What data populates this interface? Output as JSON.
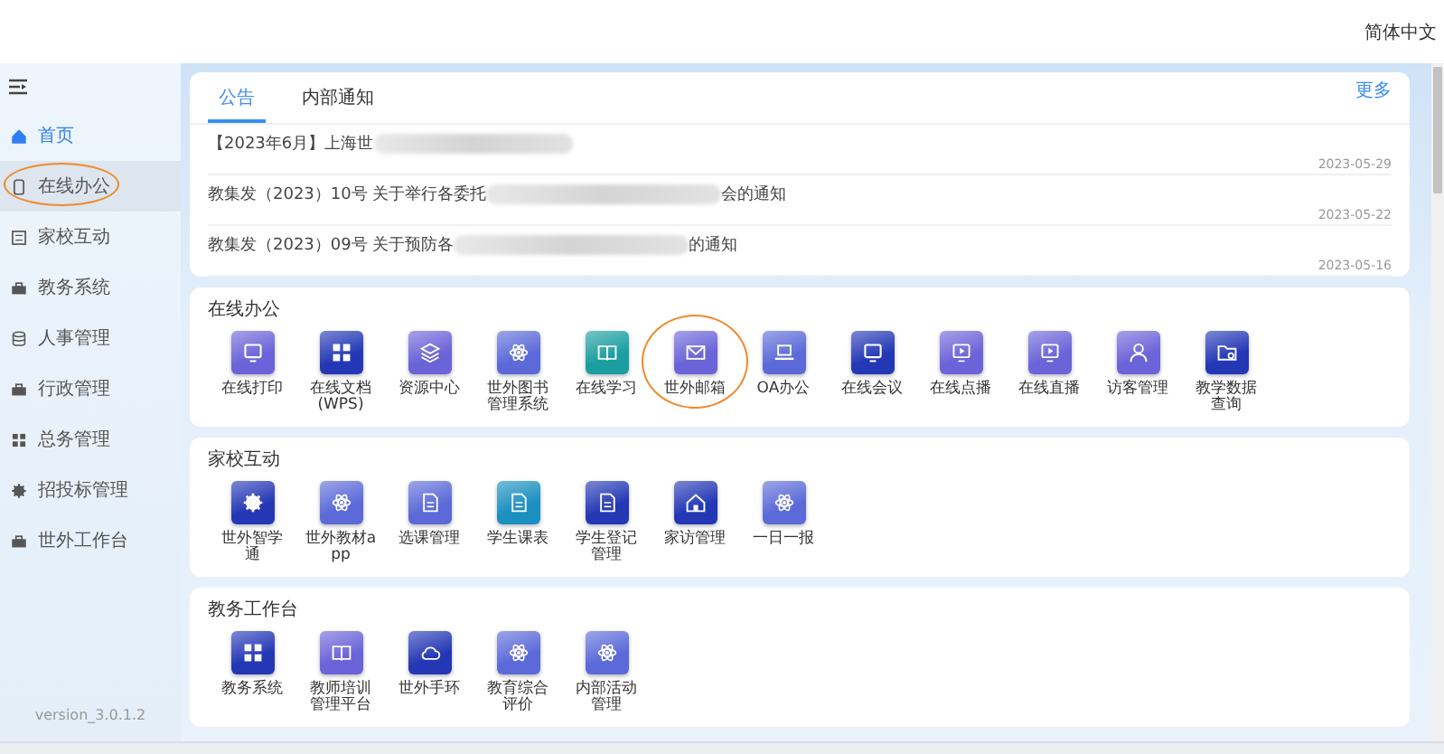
{
  "header": {
    "language": "简体中文"
  },
  "sidebar": {
    "items": [
      {
        "label": "首页",
        "kind": "home",
        "selected": false,
        "active": true,
        "highlighted": false
      },
      {
        "label": "在线办公",
        "kind": "tablet",
        "selected": true,
        "active": false,
        "highlighted": true
      },
      {
        "label": "家校互动",
        "kind": "frame",
        "selected": false,
        "active": false,
        "highlighted": false
      },
      {
        "label": "教务系统",
        "kind": "briefcase",
        "selected": false,
        "active": false,
        "highlighted": false
      },
      {
        "label": "人事管理",
        "kind": "database",
        "selected": false,
        "active": false,
        "highlighted": false
      },
      {
        "label": "行政管理",
        "kind": "briefcase",
        "selected": false,
        "active": false,
        "highlighted": false
      },
      {
        "label": "总务管理",
        "kind": "grid",
        "selected": false,
        "active": false,
        "highlighted": false
      },
      {
        "label": "招投标管理",
        "kind": "gear",
        "selected": false,
        "active": false,
        "highlighted": false
      },
      {
        "label": "世外工作台",
        "kind": "briefcase",
        "selected": false,
        "active": false,
        "highlighted": false
      }
    ],
    "version": "version_3.0.1.2"
  },
  "notices": {
    "tabs": [
      {
        "label": "公告",
        "selected": true
      },
      {
        "label": "内部通知",
        "selected": false
      }
    ],
    "more": "更多",
    "rows": [
      {
        "title_start": "【2023年6月】上海世",
        "title_end": "",
        "date": "2023-05-29"
      },
      {
        "title_start": "教集发（2023）10号 关于举行各委托",
        "title_end": "会的通知",
        "date": "2023-05-22"
      },
      {
        "title_start": "教集发（2023）09号 关于预防各",
        "title_end": "的通知",
        "date": "2023-05-16"
      }
    ]
  },
  "sections": [
    {
      "title": "在线办公",
      "apps": [
        {
          "label": "在线打印",
          "kind": "monitor",
          "color": "#6b63d8",
          "highlighted": false
        },
        {
          "label": "在线文档(WPS)",
          "kind": "grid",
          "color": "#2438b5",
          "highlighted": false
        },
        {
          "label": "资源中心",
          "kind": "layers",
          "color": "#6b63d8",
          "highlighted": false
        },
        {
          "label": "世外图书管理系统",
          "kind": "atom",
          "color": "#5b6ad8",
          "highlighted": false
        },
        {
          "label": "在线学习",
          "kind": "book",
          "color": "#1a9ea0",
          "highlighted": false
        },
        {
          "label": "世外邮箱",
          "kind": "mail",
          "color": "#6b63d8",
          "highlighted": true
        },
        {
          "label": "OA办公",
          "kind": "laptop",
          "color": "#5b6ad8",
          "highlighted": false
        },
        {
          "label": "在线会议",
          "kind": "monitor",
          "color": "#2438b5",
          "highlighted": false
        },
        {
          "label": "在线点播",
          "kind": "play",
          "color": "#6b63d8",
          "highlighted": false
        },
        {
          "label": "在线直播",
          "kind": "play",
          "color": "#6b63d8",
          "highlighted": false
        },
        {
          "label": "访客管理",
          "kind": "person",
          "color": "#6b63d8",
          "highlighted": false
        },
        {
          "label": "教学数据查询",
          "kind": "folder",
          "color": "#2438b5",
          "highlighted": false
        }
      ]
    },
    {
      "title": "家校互动",
      "apps": [
        {
          "label": "世外智学通",
          "kind": "gear",
          "color": "#2438b5",
          "highlighted": false
        },
        {
          "label": "世外教材app",
          "kind": "atom",
          "color": "#5b6ad8",
          "highlighted": false
        },
        {
          "label": "选课管理",
          "kind": "doc",
          "color": "#5b6ad8",
          "highlighted": false
        },
        {
          "label": "学生课表",
          "kind": "doc",
          "color": "#1a8fc0",
          "highlighted": false
        },
        {
          "label": "学生登记管理",
          "kind": "doc",
          "color": "#2438b5",
          "highlighted": false
        },
        {
          "label": "家访管理",
          "kind": "house",
          "color": "#2438b5",
          "highlighted": false
        },
        {
          "label": "一日一报",
          "kind": "atom",
          "color": "#5b6ad8",
          "highlighted": false
        }
      ]
    },
    {
      "title": "教务工作台",
      "apps": [
        {
          "label": "教务系统",
          "kind": "grid",
          "color": "#2438b5",
          "highlighted": false
        },
        {
          "label": "教师培训管理平台",
          "kind": "book",
          "color": "#6b63d8",
          "highlighted": false
        },
        {
          "label": "世外手环",
          "kind": "cloud",
          "color": "#2438b5",
          "highlighted": false
        },
        {
          "label": "教育综合评价",
          "kind": "atom",
          "color": "#5b6ad8",
          "highlighted": false
        },
        {
          "label": "内部活动管理",
          "kind": "atom",
          "color": "#5b6ad8",
          "highlighted": false
        }
      ]
    }
  ]
}
